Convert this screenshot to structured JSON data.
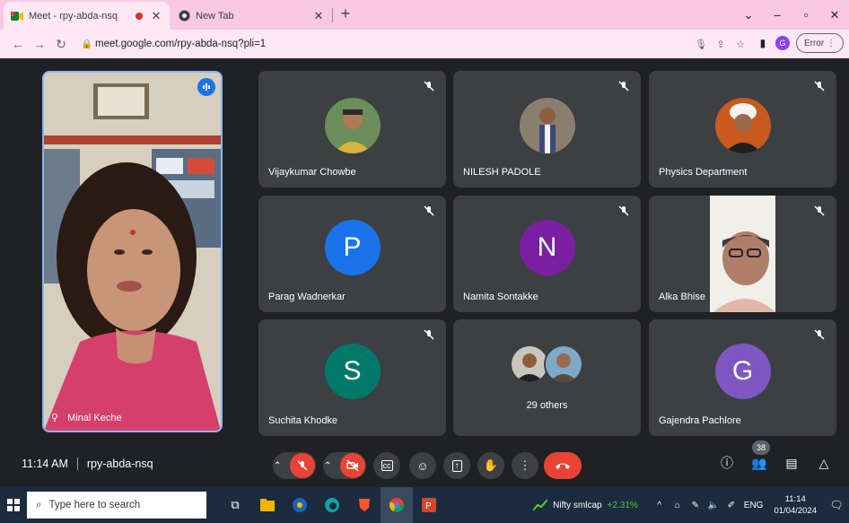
{
  "browser": {
    "tabs": [
      {
        "title": "Meet - rpy-abda-nsq"
      },
      {
        "title": "New Tab"
      }
    ],
    "url": "meet.google.com/rpy-abda-nsq?pli=1",
    "profile_initial": "G",
    "error_label": "Error"
  },
  "self_tile": {
    "name": "Minal Keche"
  },
  "tiles": [
    {
      "name": "Vijaykumar Chowbe",
      "kind": "photo"
    },
    {
      "name": "NILESH PADOLE",
      "kind": "photo"
    },
    {
      "name": "Physics Department",
      "kind": "photo"
    },
    {
      "name": "Parag Wadnerkar",
      "kind": "letter",
      "letter": "P",
      "color": "#1a73e8"
    },
    {
      "name": "Namita Sontakke",
      "kind": "letter",
      "letter": "N",
      "color": "#7b1fa2"
    },
    {
      "name": "Alka Bhise",
      "kind": "video"
    },
    {
      "name": "Suchita Khodke",
      "kind": "letter",
      "letter": "S",
      "color": "#00796b"
    },
    {
      "name": "29 others",
      "kind": "others"
    },
    {
      "name": "Gajendra Pachlore",
      "kind": "letter",
      "letter": "G",
      "color": "#7e57c2"
    }
  ],
  "meeting": {
    "time": "11:14 AM",
    "code": "rpy-abda-nsq",
    "participants_count": "38"
  },
  "taskbar": {
    "search_placeholder": "Type here to search",
    "ticker_name": "Nifty smlcap",
    "ticker_change": "+2.31%",
    "lang": "ENG",
    "time": "11:14",
    "date": "01/04/2024"
  },
  "colors": {
    "accent": "#8ab4f8",
    "end_call": "#ea4335",
    "tile_bg": "#3c4043",
    "stage_bg": "#202124"
  }
}
